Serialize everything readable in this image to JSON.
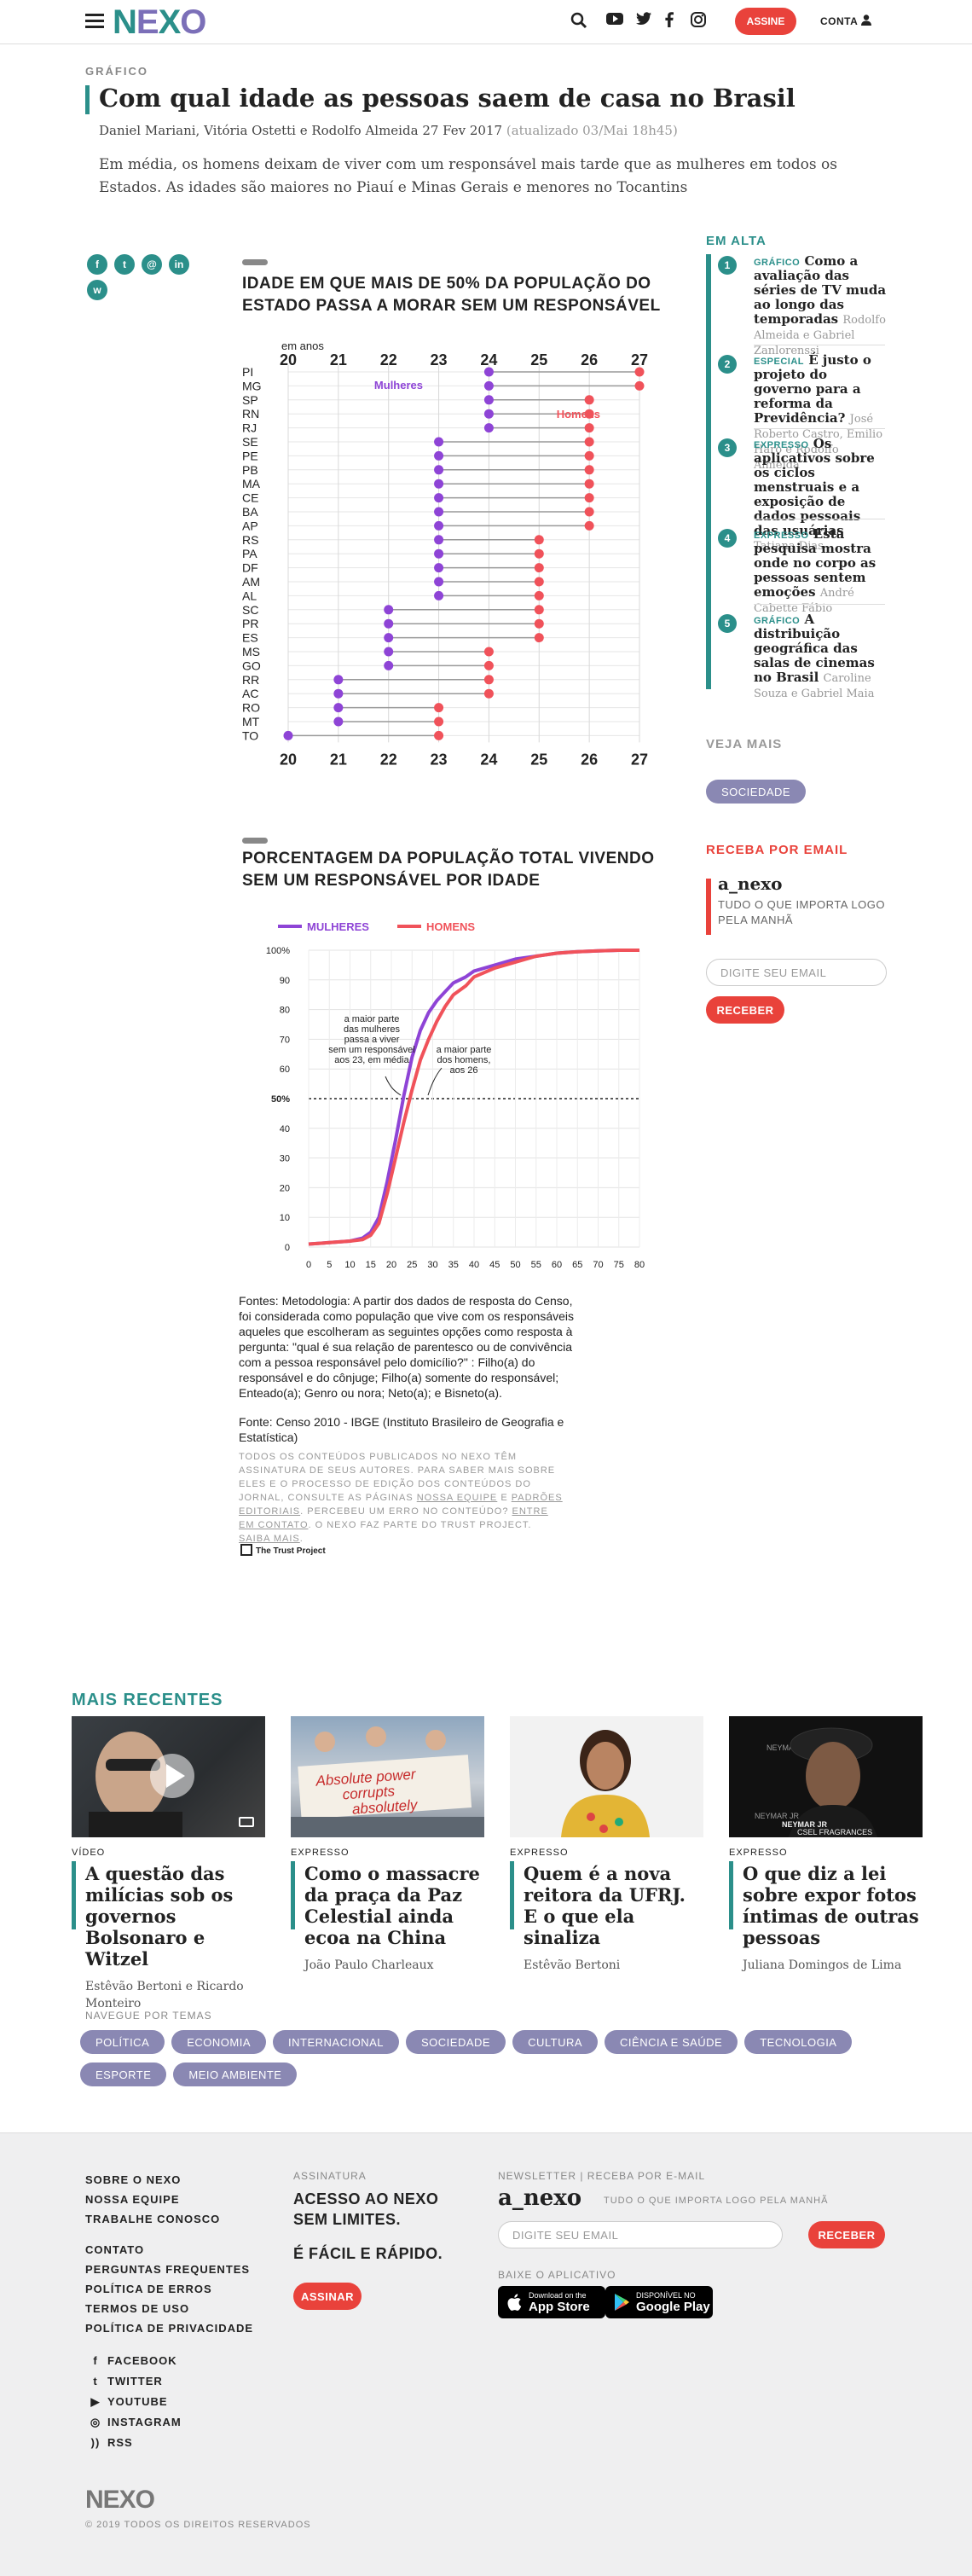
{
  "header": {
    "logo": [
      "N",
      "E",
      "X",
      "O"
    ],
    "assine": "ASSINE",
    "conta": "CONTA"
  },
  "article": {
    "category": "GRÁFICO",
    "title": "Com qual idade as pessoas saem de casa no Brasil",
    "byline": "Daniel Mariani, Vitória Ostetti e Rodolfo Almeida",
    "date": "27 Fev 2017",
    "updated": "(atualizado 03/Mai 18h45)",
    "lede": "Em média, os homens deixam de viver com um responsável mais tarde que as mulheres em todos os Estados. As idades são maiores no Piauí e Minas Gerais e menores no Tocantins"
  },
  "share": [
    {
      "icon": "facebook-icon",
      "glyph": "f"
    },
    {
      "icon": "twitter-icon",
      "glyph": "t"
    },
    {
      "icon": "email-icon",
      "glyph": "@"
    },
    {
      "icon": "linkedin-icon",
      "glyph": "in"
    },
    {
      "icon": "whatsapp-icon",
      "glyph": "w"
    }
  ],
  "chart1": {
    "heading": "IDADE EM QUE MAIS DE 50% DA POPULAÇÃO DO ESTADO PASSA A MORAR SEM UM RESPONSÁVEL",
    "unit_label": "em anos",
    "legend_women": "Mulheres",
    "legend_men": "Homens"
  },
  "chart2": {
    "heading": "PORCENTAGEM DA POPULAÇÃO TOTAL VIVENDO SEM UM RESPONSÁVEL POR IDADE",
    "legend_women": "MULHERES",
    "legend_men": "HOMENS",
    "annotation_women": [
      "a maior parte",
      "das mulheres",
      "passa a viver",
      "sem um responsável",
      "aos 23, em média"
    ],
    "annotation_men": [
      "a maior parte",
      "dos homens,",
      "aos 26"
    ],
    "fifty_label": "50%"
  },
  "chart_data": [
    {
      "type": "scatter",
      "title": "IDADE EM QUE MAIS DE 50% DA POPULAÇÃO DO ESTADO PASSA A MORAR SEM UM RESPONSÁVEL",
      "xlabel": "em anos",
      "xlim": [
        20,
        27
      ],
      "xticks": [
        20,
        21,
        22,
        23,
        24,
        25,
        26,
        27
      ],
      "categories": [
        "PI",
        "MG",
        "SP",
        "RN",
        "RJ",
        "SE",
        "PE",
        "PB",
        "MA",
        "CE",
        "BA",
        "AP",
        "RS",
        "PA",
        "DF",
        "AM",
        "AL",
        "SC",
        "PR",
        "ES",
        "MS",
        "GO",
        "RR",
        "AC",
        "RO",
        "MT",
        "TO"
      ],
      "series": [
        {
          "name": "Mulheres",
          "color": "#8e44d6",
          "values": [
            24,
            24,
            24,
            24,
            24,
            23,
            23,
            23,
            23,
            23,
            23,
            23,
            23,
            23,
            23,
            23,
            23,
            22,
            22,
            22,
            22,
            22,
            21,
            21,
            21,
            21,
            20
          ]
        },
        {
          "name": "Homens",
          "color": "#f0525a",
          "values": [
            27,
            27,
            26,
            26,
            26,
            26,
            26,
            26,
            26,
            26,
            26,
            26,
            25,
            25,
            25,
            25,
            25,
            25,
            25,
            25,
            24,
            24,
            24,
            24,
            23,
            23,
            23
          ]
        }
      ]
    },
    {
      "type": "line",
      "title": "PORCENTAGEM DA POPULAÇÃO TOTAL VIVENDO SEM UM RESPONSÁVEL POR IDADE",
      "xlim": [
        0,
        80
      ],
      "ylim": [
        0,
        100
      ],
      "xticks": [
        0,
        5,
        10,
        15,
        20,
        25,
        30,
        35,
        40,
        45,
        50,
        55,
        60,
        65,
        70,
        75,
        80
      ],
      "yticks": [
        0,
        10,
        20,
        30,
        40,
        50,
        60,
        70,
        80,
        90,
        100
      ],
      "ytick_labels": [
        "0",
        "10",
        "20",
        "30",
        "40",
        "50%",
        "60",
        "70",
        "80",
        "90",
        "100%"
      ],
      "series": [
        {
          "name": "MULHERES",
          "color": "#8e44d6",
          "x": [
            0,
            5,
            10,
            13,
            15,
            17,
            19,
            21,
            23,
            25,
            27,
            29,
            31,
            33,
            35,
            38,
            40,
            45,
            50,
            55,
            60,
            65,
            70,
            75,
            80
          ],
          "y": [
            1,
            1.5,
            2,
            3,
            5,
            10,
            22,
            36,
            51,
            64,
            73,
            79,
            83,
            86,
            89,
            91,
            93,
            95,
            97,
            98,
            99,
            99.5,
            99.8,
            100,
            100
          ]
        },
        {
          "name": "HOMENS",
          "color": "#f0525a",
          "x": [
            0,
            5,
            10,
            13,
            15,
            17,
            19,
            21,
            23,
            25,
            27,
            29,
            31,
            33,
            35,
            38,
            40,
            45,
            50,
            55,
            60,
            65,
            70,
            75,
            80
          ],
          "y": [
            1,
            1.5,
            2,
            2.5,
            4,
            8,
            18,
            30,
            42,
            53,
            63,
            70,
            76,
            81,
            85,
            88,
            91,
            94,
            96,
            98,
            99,
            99.5,
            99.8,
            100,
            100
          ]
        }
      ]
    }
  ],
  "sidebar": {
    "em_alta": "EM ALTA",
    "items": [
      {
        "num": "1",
        "kind": "GRÁFICO",
        "title": "Como a avaliação das séries de TV muda ao longo das temporadas",
        "authors": "Rodolfo Almeida e Gabriel Zanlorenssi"
      },
      {
        "num": "2",
        "kind": "ESPECIAL",
        "title": "É justo o projeto do governo para a reforma da Previdência?",
        "authors": "José Roberto Castro, Emilio Haro e Rodolfo Almeida"
      },
      {
        "num": "3",
        "kind": "EXPRESSO",
        "title": "Os aplicativos sobre os ciclos menstruais e a exposição de dados pessoais das usuárias",
        "authors": "Tatiana Dias"
      },
      {
        "num": "4",
        "kind": "EXPRESSO",
        "title": "Esta pesquisa mostra onde no corpo as pessoas sentem emoções",
        "authors": "André Cabette Fábio"
      },
      {
        "num": "5",
        "kind": "GRÁFICO",
        "title": "A distribuição geográfica das salas de cinemas no Brasil",
        "authors": "Caroline Souza e Gabriel Maia"
      }
    ],
    "veja_mais": "VEJA MAIS",
    "veja_tag": "SOCIEDADE",
    "receba": "RECEBA POR EMAIL",
    "anexo": "a_nexo",
    "anexo_sub": "TUDO O QUE IMPORTA LOGO PELA MANHÃ",
    "email_placeholder": "DIGITE SEU EMAIL",
    "receber": "RECEBER"
  },
  "footnotes": {
    "fontes": "Fontes: Metodologia: A partir dos dados de resposta do Censo, foi considerada como população que vive com os responsáveis aqueles que escolheram as seguintes opções como resposta à pergunta: \"qual é sua relação de parentesco ou de convivência com a pessoa responsável pelo domicílio?\" : Filho(a) do responsável e do cônjuge; Filho(a) somente do responsável; Enteado(a); Genro ou nora; Neto(a); e Bisneto(a).",
    "fonte2": "Fonte: Censo 2010 - IBGE (Instituto Brasileiro de Geografia e Estatística)",
    "terms_a": "Todos os conteúdos publicados no Nexo têm assinatura de seus autores. Para saber mais sobre eles e o processo de edição dos conteúdos do jornal, consulte as páginas ",
    "terms_link1": "Nossa equipe",
    "terms_b": " e ",
    "terms_link2": "Padrões editoriais",
    "terms_c": ". Percebeu um erro no conteúdo? ",
    "terms_link3": "Entre em contato",
    "terms_d": ". O Nexo faz parte do Trust Project. ",
    "terms_link4": "Saiba mais",
    "terms_e": ".",
    "trust": "The Trust Project"
  },
  "recentes": {
    "heading": "MAIS RECENTES",
    "cards": [
      {
        "kind": "VÍDEO",
        "title": "A questão das milícias sob os governos Bolsonaro e Witzel",
        "authors": "Estêvão Bertoni e Ricardo Monteiro"
      },
      {
        "kind": "EXPRESSO",
        "title": "Como o massacre da praça da Paz Celestial ainda ecoa na China",
        "authors": "João Paulo Charleaux",
        "sign": [
          "Absolute power",
          "corrupts",
          "absolutely"
        ]
      },
      {
        "kind": "EXPRESSO",
        "title": "Quem é a nova reitora da UFRJ. E o que ela sinaliza",
        "authors": "Estêvão Bertoni"
      },
      {
        "kind": "EXPRESSO",
        "title": "O que diz a lei sobre expor fotos íntimas de outras pessoas",
        "authors": "Juliana Domingos de Lima",
        "sign": [
          "NEYMAR JR",
          "x",
          "CSEL FRAGRANCES"
        ]
      }
    ]
  },
  "temas": {
    "label": "NAVEGUE POR TEMAS",
    "items": [
      "POLÍTICA",
      "ECONOMIA",
      "INTERNACIONAL",
      "SOCIEDADE",
      "CULTURA",
      "CIÊNCIA E SAÚDE",
      "TECNOLOGIA",
      "ESPORTE",
      "MEIO AMBIENTE"
    ]
  },
  "footer": {
    "links1": [
      "SOBRE O NEXO",
      "NOSSA EQUIPE",
      "TRABALHE CONOSCO"
    ],
    "links2": [
      "CONTATO",
      "PERGUNTAS FREQUENTES",
      "POLÍTICA DE ERROS",
      "TERMOS DE USO",
      "POLÍTICA DE PRIVACIDADE"
    ],
    "social": [
      {
        "label": "FACEBOOK",
        "glyph": "f"
      },
      {
        "label": "TWITTER",
        "glyph": "t"
      },
      {
        "label": "YOUTUBE",
        "glyph": "▶"
      },
      {
        "label": "INSTAGRAM",
        "glyph": "◎"
      },
      {
        "label": "RSS",
        "glyph": "))"
      }
    ],
    "assinatura": "ASSINATURA",
    "acesso": "ACESSO AO NEXO SEM LIMITES.",
    "facil": "É FÁCIL E RÁPIDO.",
    "assinar": "ASSINAR",
    "newsletter": "NEWSLETTER | RECEBA POR E-MAIL",
    "anexo": "a_nexo",
    "anexo_sub": "TUDO O QUE IMPORTA LOGO PELA MANHÃ",
    "email_placeholder": "DIGITE SEU EMAIL",
    "receber": "RECEBER",
    "baixe": "BAIXE O APLICATIVO",
    "appstore_small": "Download on the",
    "appstore_big": "App Store",
    "gplay_small": "DISPONÍVEL NO",
    "gplay_big": "Google Play",
    "logo": "NEXO",
    "copyright": "© 2019 TODOS OS DIREITOS RESERVADOS"
  },
  "colors": {
    "teal": "#2b8f8a",
    "purple": "#8e44d6",
    "red": "#f0525a",
    "brand_red": "#e9423b",
    "tag": "#8a88b3"
  }
}
